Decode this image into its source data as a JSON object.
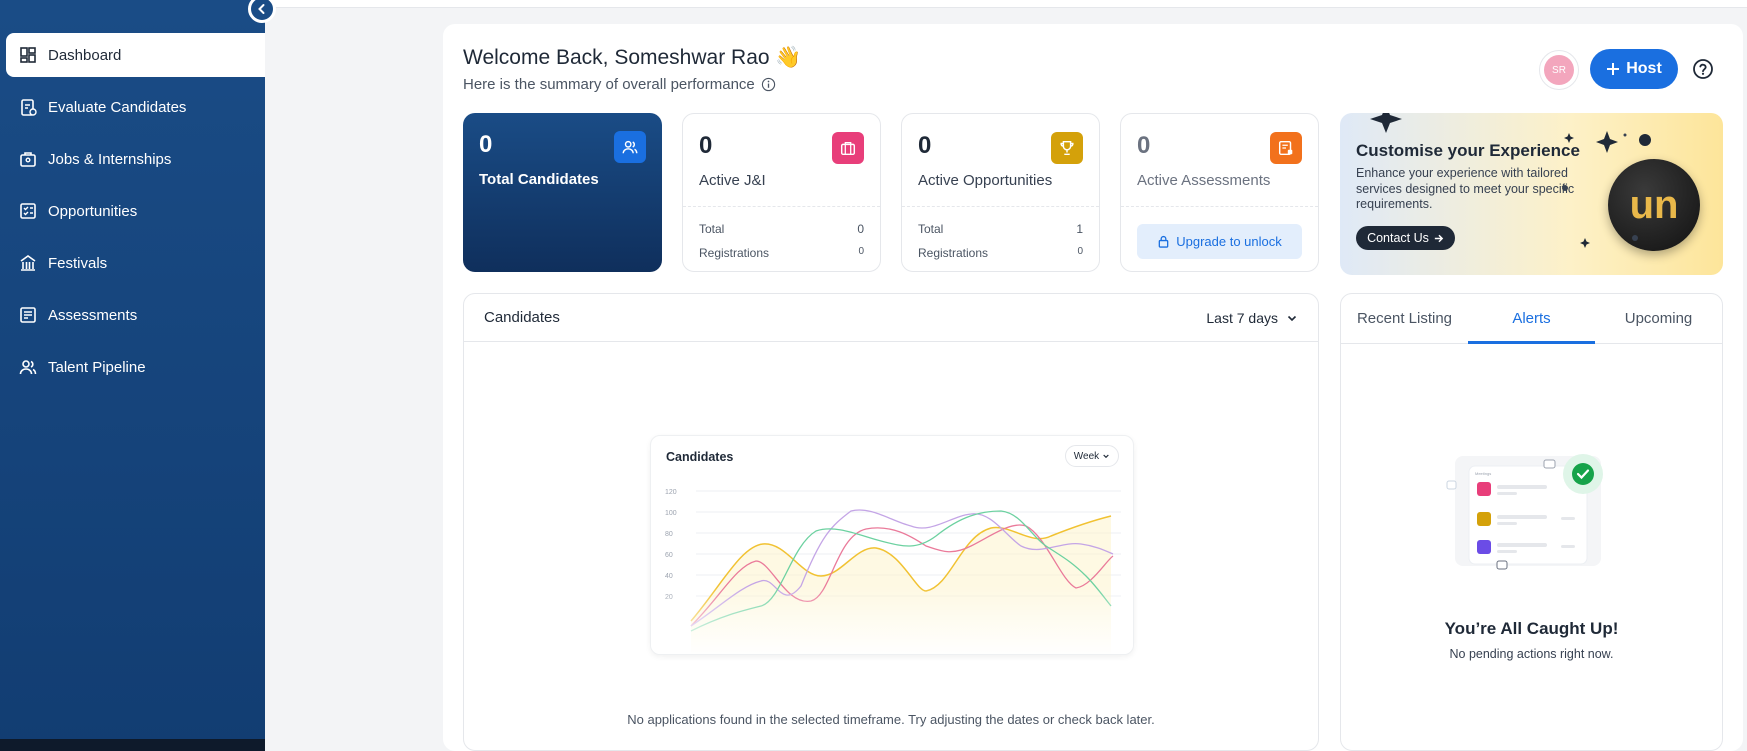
{
  "sidebar": {
    "items": [
      {
        "label": "Dashboard",
        "icon": "dashboard-icon",
        "active": true
      },
      {
        "label": "Evaluate Candidates",
        "icon": "clipboard-icon"
      },
      {
        "label": "Jobs & Internships",
        "icon": "briefcase-icon"
      },
      {
        "label": "Opportunities",
        "icon": "checklist-icon"
      },
      {
        "label": "Festivals",
        "icon": "building-icon"
      },
      {
        "label": "Assessments",
        "icon": "document-icon"
      },
      {
        "label": "Talent Pipeline",
        "icon": "users-icon"
      }
    ]
  },
  "header": {
    "welcome": "Welcome Back, Someshwar Rao 👋",
    "subtitle": "Here is the summary of overall performance",
    "avatar_initials": "SR",
    "host_label": "Host"
  },
  "stats": {
    "total_candidates": {
      "value": "0",
      "label": "Total Candidates"
    },
    "active_ji": {
      "value": "0",
      "label": "Active J&I",
      "total_label": "Total",
      "total_value": "0",
      "reg_label": "Registrations",
      "reg_value": "0"
    },
    "active_opportunities": {
      "value": "0",
      "label": "Active Opportunities",
      "total_label": "Total",
      "total_value": "1",
      "reg_label": "Registrations",
      "reg_value": "0"
    },
    "active_assessments": {
      "value": "0",
      "label": "Active Assessments",
      "unlock_label": "Upgrade to unlock"
    }
  },
  "promo": {
    "title": "Customise your Experience",
    "description": "Enhance your experience with tailored services designed to meet your specific requirements.",
    "cta": "Contact Us",
    "logo_text": "un"
  },
  "candidates_panel": {
    "title": "Candidates",
    "range": "Last 7 days",
    "preview_title": "Candidates",
    "preview_range": "Week",
    "y_ticks": [
      "120",
      "100",
      "80",
      "60",
      "40",
      "20"
    ],
    "empty_message": "No applications found in the selected timeframe. Try adjusting the dates or check back later."
  },
  "tabs_panel": {
    "tabs": [
      "Recent Listing",
      "Alerts",
      "Upcoming"
    ],
    "active_tab": "Alerts",
    "illustration_header": "Meetings",
    "caught_title": "You’re All Caught Up!",
    "caught_sub": "No pending actions right now."
  },
  "colors": {
    "sidebar": "#1a4c86",
    "primary": "#1a6fe0",
    "pink": "#e83e7a",
    "gold": "#d4a10a",
    "orange": "#f2711c"
  }
}
